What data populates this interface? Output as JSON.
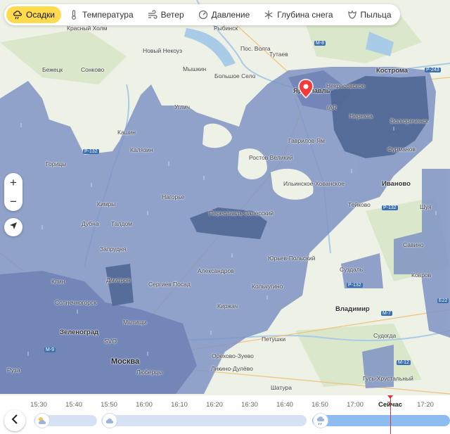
{
  "layers": [
    {
      "label": "Осадки",
      "icon": "precipitation-icon",
      "active": true
    },
    {
      "label": "Температура",
      "icon": "thermometer-icon",
      "active": false
    },
    {
      "label": "Ветер",
      "icon": "wind-icon",
      "active": false
    },
    {
      "label": "Давление",
      "icon": "gauge-icon",
      "active": false
    },
    {
      "label": "Глубина снега",
      "icon": "snowflake-icon",
      "active": false
    },
    {
      "label": "Пыльца",
      "icon": "pollen-icon",
      "active": false
    }
  ],
  "controls": {
    "zoom_in": "+",
    "zoom_out": "−"
  },
  "map": {
    "colors": {
      "land": "#eef1e6",
      "water": "#a8cbe8",
      "precip_light": "#8a9bc4",
      "precip_mid": "#6f83b4",
      "precip_heavy": "#4d6491",
      "forest": "#d7e6c8"
    },
    "cities": [
      {
        "name": "Москва",
        "size": "big"
      },
      {
        "name": "Ярославль",
        "size": "med"
      },
      {
        "name": "Кострома",
        "size": "med"
      },
      {
        "name": "Иваново",
        "size": "med"
      },
      {
        "name": "Владимир",
        "size": "med"
      },
      {
        "name": "Зеленоград",
        "size": "med"
      },
      {
        "name": "Красный Холм",
        "size": "small"
      },
      {
        "name": "Рыбинск",
        "size": "small"
      },
      {
        "name": "Новый Некоуз",
        "size": "small"
      },
      {
        "name": "Тутаев",
        "size": "small"
      },
      {
        "name": "Бежецк",
        "size": "small"
      },
      {
        "name": "Сонково",
        "size": "small"
      },
      {
        "name": "Мышкин",
        "size": "small"
      },
      {
        "name": "Большое Село",
        "size": "small"
      },
      {
        "name": "Некрасовское",
        "size": "small"
      },
      {
        "name": "Кашин",
        "size": "small"
      },
      {
        "name": "Углич",
        "size": "small"
      },
      {
        "name": "Калязин",
        "size": "small"
      },
      {
        "name": "Нерехта",
        "size": "small"
      },
      {
        "name": "Волгореченск",
        "size": "small"
      },
      {
        "name": "Гаврилов-Ям",
        "size": "small"
      },
      {
        "name": "Фурманов",
        "size": "small"
      },
      {
        "name": "Горицы",
        "size": "small"
      },
      {
        "name": "Ростов Великий",
        "size": "small"
      },
      {
        "name": "Ильинское-Хованское",
        "size": "small"
      },
      {
        "name": "Нагорье",
        "size": "small"
      },
      {
        "name": "Кимры",
        "size": "small"
      },
      {
        "name": "Тейково",
        "size": "small"
      },
      {
        "name": "Шуя",
        "size": "small"
      },
      {
        "name": "Дубна",
        "size": "small"
      },
      {
        "name": "Талдом",
        "size": "small"
      },
      {
        "name": "Переславль-Залесский",
        "size": "small"
      },
      {
        "name": "Савино",
        "size": "small"
      },
      {
        "name": "Запрудня",
        "size": "small"
      },
      {
        "name": "Юрьев-Польский",
        "size": "small"
      },
      {
        "name": "Суздаль",
        "size": "small"
      },
      {
        "name": "Ковров",
        "size": "small"
      },
      {
        "name": "Александров",
        "size": "small"
      },
      {
        "name": "Клин",
        "size": "small"
      },
      {
        "name": "Дмитров",
        "size": "small"
      },
      {
        "name": "Сергиев Посад",
        "size": "small"
      },
      {
        "name": "Кольчугино",
        "size": "small"
      },
      {
        "name": "Солнечногорск",
        "size": "small"
      },
      {
        "name": "Киржач",
        "size": "small"
      },
      {
        "name": "Мытищи",
        "size": "small"
      },
      {
        "name": "Петушки",
        "size": "small"
      },
      {
        "name": "Судогда",
        "size": "small"
      },
      {
        "name": "Орехово-Зуево",
        "size": "small"
      },
      {
        "name": "Ликино-Дулёво",
        "size": "small"
      },
      {
        "name": "Люберцы",
        "size": "small"
      },
      {
        "name": "Руза",
        "size": "small"
      },
      {
        "name": "Гусь-Хрустальный",
        "size": "small"
      },
      {
        "name": "Шатура",
        "size": "small"
      },
      {
        "name": "Пос. Волга",
        "size": "small"
      }
    ],
    "road_shields": [
      "М-8",
      "Р-243",
      "Р-132",
      "Р-132",
      "Р-132",
      "М-7",
      "Е22",
      "М-12",
      "М-9"
    ],
    "airport_labels": [
      "IAR",
      "SVO"
    ]
  },
  "timeline": {
    "times": [
      "15:30",
      "15:40",
      "15:50",
      "16:00",
      "16:10",
      "16:20",
      "16:30",
      "16:40",
      "16:50",
      "17:00",
      "Сейчас",
      "17:20"
    ],
    "now_label": "Сейчас",
    "segment_colors": {
      "past": "#d5e3f5",
      "now": "#8cbcf0"
    },
    "segment_icons": [
      "partly-cloudy-icon",
      "cloud-icon",
      "rain-cloud-icon"
    ]
  }
}
